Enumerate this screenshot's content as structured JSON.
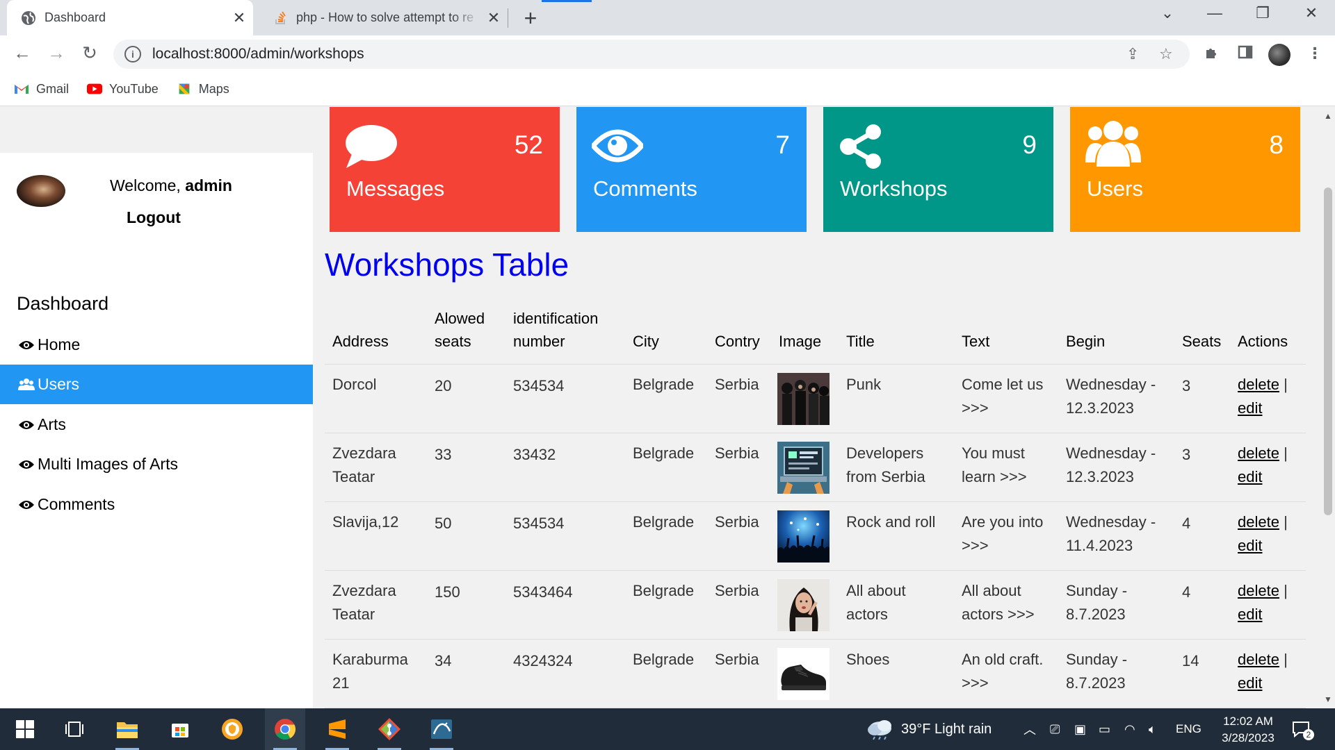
{
  "browser": {
    "tabs": [
      {
        "title": "Dashboard",
        "active": true
      },
      {
        "title": "php - How to solve attempt to re",
        "active": false
      }
    ],
    "url": "localhost:8000/admin/workshops",
    "bookmarks": [
      "Gmail",
      "YouTube",
      "Maps"
    ]
  },
  "sidebar": {
    "welcome_prefix": "Welcome,",
    "username": "admin",
    "logout": "Logout",
    "title": "Dashboard",
    "items": [
      {
        "label": "Home",
        "icon": "eye-icon",
        "active": false
      },
      {
        "label": "Users",
        "icon": "users-icon",
        "active": true
      },
      {
        "label": "Arts",
        "icon": "eye-icon",
        "active": false
      },
      {
        "label": "Multi Images of Arts",
        "icon": "eye-icon",
        "active": false
      },
      {
        "label": "Comments",
        "icon": "eye-icon",
        "active": false
      }
    ]
  },
  "cards": [
    {
      "label": "Messages",
      "count": "52",
      "color": "#f44336",
      "icon": "comment-icon"
    },
    {
      "label": "Comments",
      "count": "7",
      "color": "#2196f3",
      "icon": "eye-icon"
    },
    {
      "label": "Workshops",
      "count": "9",
      "color": "#009688",
      "icon": "share-icon"
    },
    {
      "label": "Users",
      "count": "8",
      "color": "#ff9800",
      "icon": "users-icon"
    }
  ],
  "table": {
    "title": "Workshops Table",
    "headers": [
      "Address",
      "Alowed seats",
      "identification number",
      "City",
      "Contry",
      "Image",
      "Title",
      "Text",
      "Begin",
      "Seats",
      "Actions"
    ],
    "rows": [
      {
        "address": "Dorcol",
        "allowed": "20",
        "idnum": "534534",
        "city": "Belgrade",
        "country": "Serbia",
        "image": "punk-band-photo",
        "title": "Punk",
        "text": "Come let us >>>",
        "begin": "Wednesday - 12.3.2023",
        "seats": "3",
        "delete": "delete",
        "edit": "edit"
      },
      {
        "address": "Zvezdara Teatar",
        "allowed": "33",
        "idnum": "33432",
        "city": "Belgrade",
        "country": "Serbia",
        "image": "developers-laptop-photo",
        "title": "Developers from Serbia",
        "text": "You must learn >>>",
        "begin": "Wednesday - 12.3.2023",
        "seats": "3",
        "delete": "delete",
        "edit": "edit"
      },
      {
        "address": "Slavija,12",
        "allowed": "50",
        "idnum": "534534",
        "city": "Belgrade",
        "country": "Serbia",
        "image": "concert-crowd-photo",
        "title": "Rock and roll",
        "text": "Are you into >>>",
        "begin": "Wednesday - 11.4.2023",
        "seats": "4",
        "delete": "delete",
        "edit": "edit"
      },
      {
        "address": "Zvezdara Teatar",
        "allowed": "150",
        "idnum": "5343464",
        "city": "Belgrade",
        "country": "Serbia",
        "image": "actress-portrait-photo",
        "title": "All about actors",
        "text": "All about actors >>>",
        "begin": "Sunday - 8.7.2023",
        "seats": "4",
        "delete": "delete",
        "edit": "edit"
      },
      {
        "address": "Karaburma 21",
        "allowed": "34",
        "idnum": "4324324",
        "city": "Belgrade",
        "country": "Serbia",
        "image": "black-shoe-photo",
        "title": "Shoes",
        "text": "An old craft. >>>",
        "begin": "Sunday - 8.7.2023",
        "seats": "14",
        "delete": "delete",
        "edit": "edit"
      }
    ]
  },
  "taskbar": {
    "weather": "39°F  Light rain",
    "lang": "ENG",
    "time": "12:02 AM",
    "date": "3/28/2023",
    "notifications": "2"
  }
}
